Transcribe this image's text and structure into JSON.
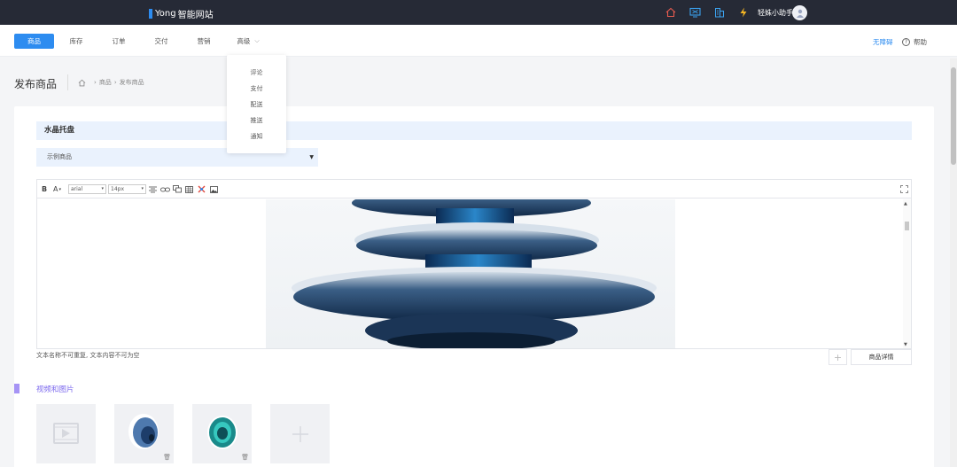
{
  "topbar": {
    "brand_mark": "I",
    "brand_name": "Yong",
    "brand_suffix": "智能网站",
    "icons": [
      "home-icon",
      "monitor-icon",
      "building-icon",
      "lightning-icon"
    ],
    "user_name": "轻姝小助手"
  },
  "nav": {
    "items": [
      {
        "label": "商品",
        "active": true
      },
      {
        "label": "库存"
      },
      {
        "label": "订单"
      },
      {
        "label": "交付"
      },
      {
        "label": "营销"
      },
      {
        "label": "高级"
      }
    ],
    "right_link": "无障碍",
    "help": "帮助"
  },
  "dropdown": {
    "items": [
      "评论",
      "支付",
      "配送",
      "推送",
      "通知"
    ]
  },
  "page": {
    "title": "发布商品",
    "breadcrumb": [
      "商品",
      "发布商品"
    ]
  },
  "product": {
    "section_title": "水晶托盘",
    "category_value": "示例商品"
  },
  "editor": {
    "font_value": "arial",
    "size_value": "14px",
    "hint": "文本名称不可重复, 文本内容不可为空",
    "detail_button": "商品详情"
  },
  "media": {
    "title": "视频和图片"
  },
  "colors": {
    "topbar": "#262a36",
    "accent": "#2d8cf0",
    "section_bg": "#eaf2fd",
    "media_accent": "#7b68ee"
  }
}
